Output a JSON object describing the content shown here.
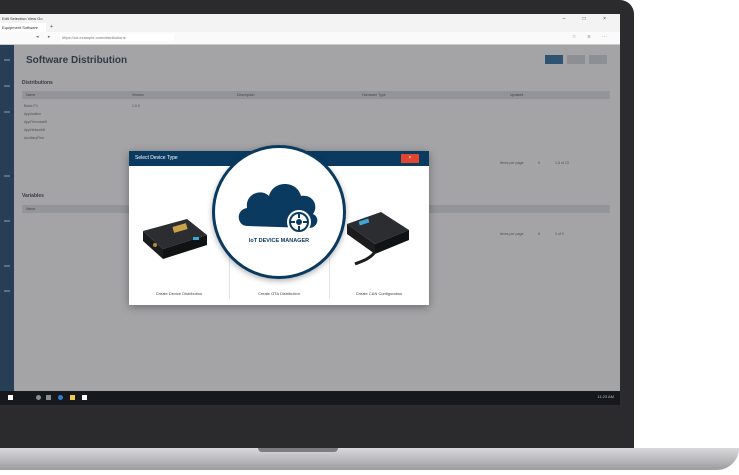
{
  "browser": {
    "menu": "Edit  Selection  View  Go",
    "tab_title": "Equipment Software",
    "new_tab": "+",
    "window_controls": "– □ ×",
    "url": "https://iot.example.com/distributions"
  },
  "app": {
    "page_title": "Software Distribution",
    "distributions_heading": "Distributions",
    "columns": [
      "Name",
      "Version",
      "Description",
      "Hardware Type",
      "Updated"
    ],
    "rows": [
      "Basic FV",
      "Application",
      "AppFirmware8",
      "AppNetwork8",
      "AuxiliaryFirm"
    ],
    "row_versions": [
      "1.0.0",
      "",
      "",
      "",
      ""
    ],
    "row_types": [
      "",
      "",
      "",
      "",
      ""
    ],
    "pager_label": "Items per page:",
    "pager_value": "5",
    "pager_range": "1-5 of 23",
    "variables_heading": "Variables",
    "variables_column": "Name",
    "pager2_label": "Items per page:",
    "pager2_value": "5",
    "pager2_range": "0 of 0"
  },
  "modal": {
    "title": "Select Device Type",
    "close_label": "×",
    "options": [
      {
        "label": "Create Device Distribution",
        "icon": "router-device-icon"
      },
      {
        "label": "Create OTA Distribution",
        "icon": "iot-device-manager-icon"
      },
      {
        "label": "Create CAN Configuration",
        "icon": "can-device-icon"
      }
    ],
    "logo_text": "IoT DEVICE MANAGER"
  },
  "taskbar": {
    "time": "11:23 AM"
  },
  "colors": {
    "brand": "#0b3a60",
    "close": "#e2442f",
    "taskbar": "#16181c"
  }
}
